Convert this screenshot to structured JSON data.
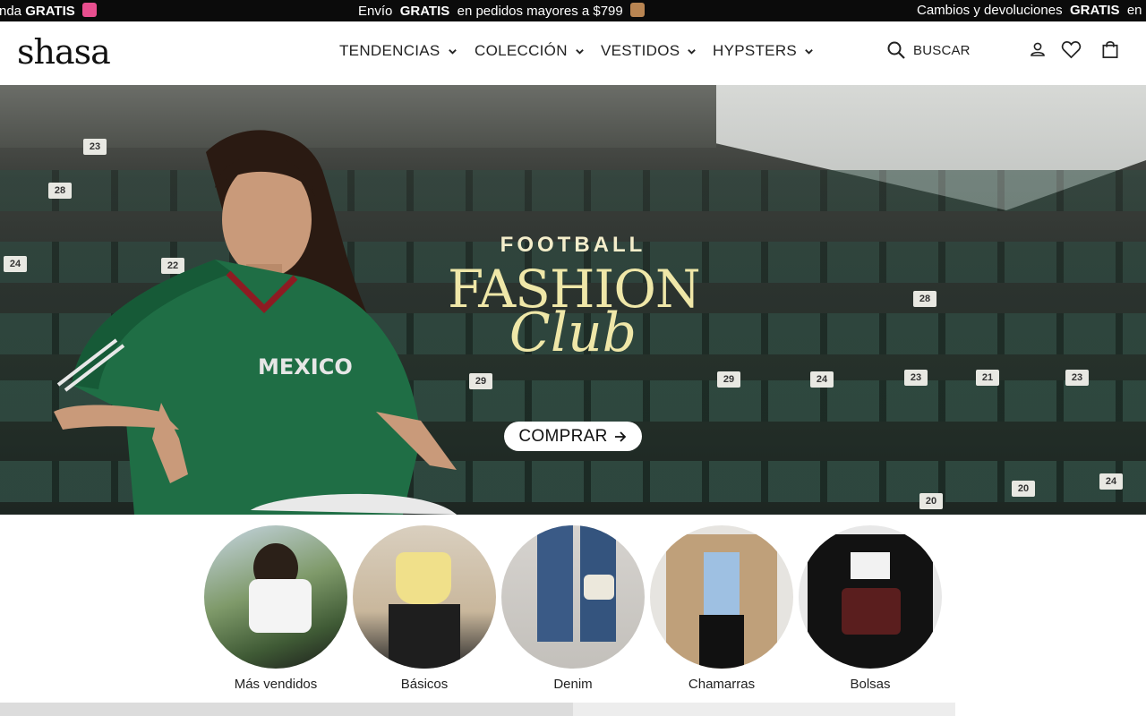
{
  "announcement": {
    "left": {
      "prefix": "nda",
      "bold": "GRATIS",
      "emoji_color": "#e84f8f"
    },
    "center": {
      "prefix": "Envío",
      "bold": "GRATIS",
      "suffix": "en pedidos mayores a $799",
      "emoji_color": "#b98552"
    },
    "right": {
      "prefix": "Cambios y devoluciones",
      "bold": "GRATIS",
      "suffix": "en"
    }
  },
  "header": {
    "logo": "shasa",
    "nav": [
      {
        "label": "TENDENCIAS"
      },
      {
        "label": "COLECCIÓN"
      },
      {
        "label": "VESTIDOS"
      },
      {
        "label": "HYPSTERS"
      }
    ],
    "search_label": "BUSCAR",
    "icons": [
      "user-icon",
      "heart-icon",
      "bag-icon"
    ]
  },
  "hero": {
    "line1": "FOOTBALL",
    "line2": "FASHION",
    "line3": "Club",
    "jersey_text": "MEXICO",
    "cta_label": "COMPRAR",
    "seat_numbers": [
      "24",
      "28",
      "23",
      "22",
      "24",
      "28",
      "29",
      "29",
      "20",
      "20",
      "24",
      "23",
      "21",
      "23"
    ],
    "accent_color": "#efe7a8"
  },
  "categories": [
    {
      "label": "Más vendidos",
      "tone": "#9aa07e"
    },
    {
      "label": "Básicos",
      "tone": "#d9c88a"
    },
    {
      "label": "Denim",
      "tone": "#8a9bb0"
    },
    {
      "label": "Chamarras",
      "tone": "#bfa07a"
    },
    {
      "label": "Bolsas",
      "tone": "#3a2b2b"
    }
  ]
}
